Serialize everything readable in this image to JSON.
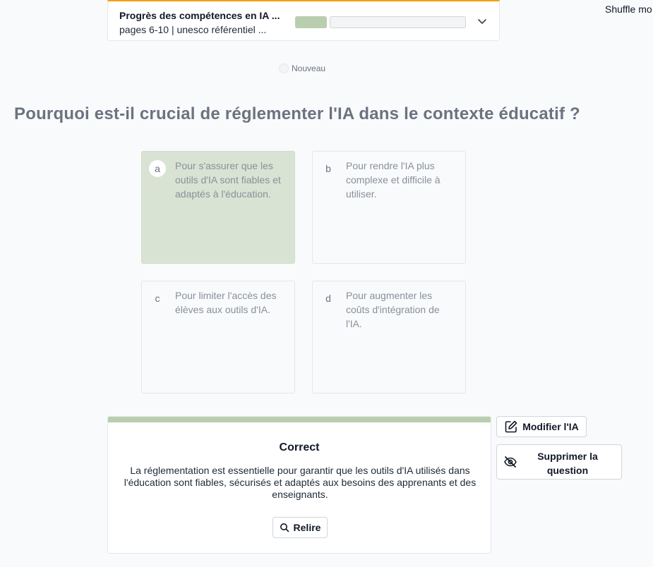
{
  "header": {
    "shuffle_label": "Shuffle mo"
  },
  "progress_card": {
    "title": "Progrès des compétences en IA ...",
    "subtitle": "pages 6-10 | unesco référentiel ...",
    "colors": {
      "done": "#b9ceae",
      "accent": "#f59e0b"
    },
    "icon": "chevron-down-icon"
  },
  "badge": {
    "label": "Nouveau"
  },
  "quiz": {
    "question": "Pourquoi est-il crucial de réglementer l'IA dans le contexte éducatif ?",
    "options": [
      {
        "letter": "a",
        "text": "Pour s'assurer que les outils d'IA sont fiables et adaptés à l'éducation.",
        "state": "correct"
      },
      {
        "letter": "b",
        "text": "Pour rendre l'IA plus complexe et difficile à utiliser."
      },
      {
        "letter": "c",
        "text": "Pour limiter l'accès des élèves aux outils d'IA."
      },
      {
        "letter": "d",
        "text": "Pour augmenter les coûts d'intégration de l'IA."
      }
    ],
    "correct_color": "#d8e3d3"
  },
  "feedback": {
    "title": "Correct",
    "text": "La réglementation est essentielle pour garantir que les outils d'IA utilisés dans l'éducation sont fiables, sécurisés et adaptés aux besoins des apprenants et des enseignants.",
    "reread_label": "Relire",
    "reread_icon": "search-icon"
  },
  "actions": {
    "edit_label": "Modifier l'IA",
    "edit_icon": "edit-icon",
    "delete_label": "Supprimer la question",
    "delete_icon": "eye-off-icon"
  }
}
